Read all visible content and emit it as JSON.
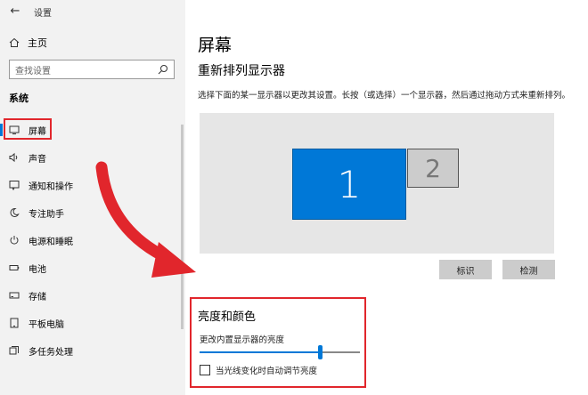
{
  "window": {
    "title": "设置",
    "back_icon": "back-arrow-icon",
    "minimize": "—",
    "maximize": "☐",
    "close": "✕"
  },
  "sidebar": {
    "home_label": "主页",
    "search_placeholder": "查找设置",
    "section_label": "系统",
    "items": [
      {
        "label": "屏幕",
        "icon": "monitor-icon",
        "active": true
      },
      {
        "label": "声音",
        "icon": "speaker-icon"
      },
      {
        "label": "通知和操作",
        "icon": "notification-icon"
      },
      {
        "label": "专注助手",
        "icon": "moon-icon"
      },
      {
        "label": "电源和睡眠",
        "icon": "power-icon"
      },
      {
        "label": "电池",
        "icon": "battery-icon"
      },
      {
        "label": "存储",
        "icon": "storage-icon"
      },
      {
        "label": "平板电脑",
        "icon": "tablet-icon"
      },
      {
        "label": "多任务处理",
        "icon": "multitask-icon"
      }
    ]
  },
  "main": {
    "page_title": "屏幕",
    "arrange_title": "重新排列显示器",
    "arrange_desc": "选择下面的某一显示器以更改其设置。长按（或选择）一个显示器，然后通过拖动方式来重新排列。",
    "monitor_1": "1",
    "monitor_2": "2",
    "identify_button": "标识",
    "detect_button": "检测",
    "brightness_title": "亮度和颜色",
    "brightness_label": "更改内置显示器的亮度",
    "brightness_level": 0.75,
    "auto_brightness_label": "当光线变化时自动调节亮度",
    "auto_brightness_checked": false
  },
  "colors": {
    "accent": "#0078d7",
    "highlight_red": "#e1262c",
    "sidebar_bg": "#f2f2f2"
  }
}
